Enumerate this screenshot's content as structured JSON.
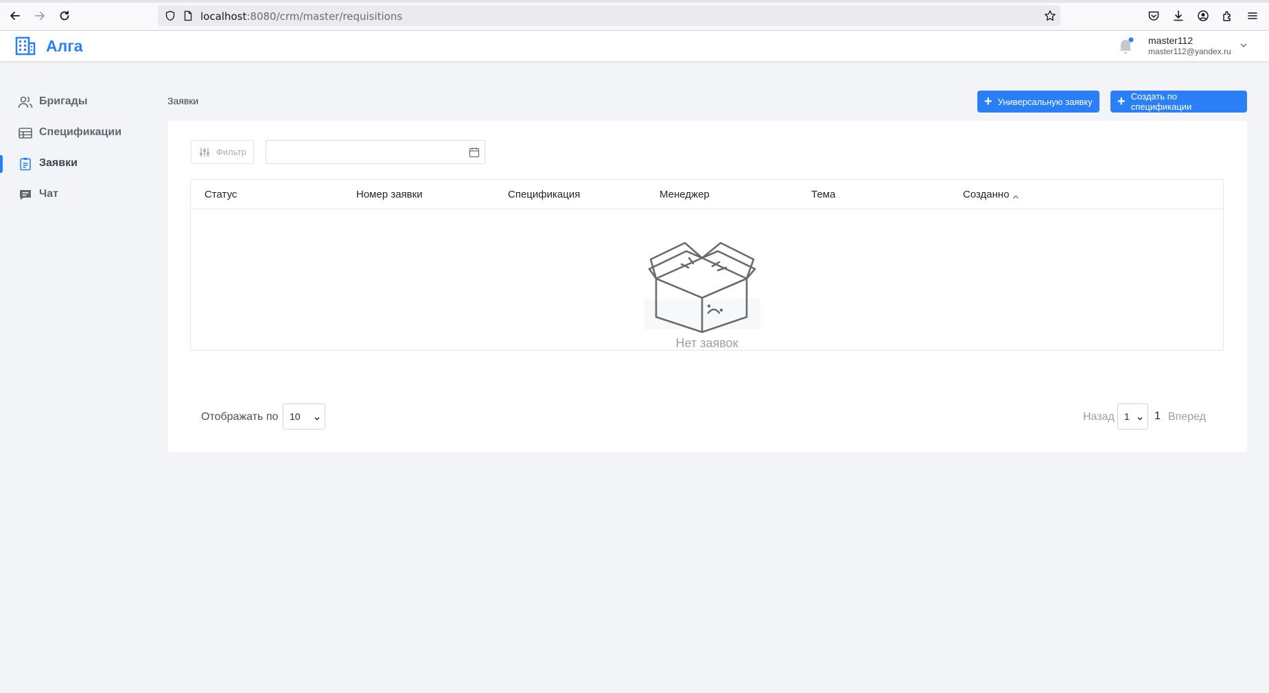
{
  "browser": {
    "url_host": "localhost",
    "url_path": ":8080/crm/master/requisitions"
  },
  "app": {
    "name": "Алга",
    "accent_color": "#2a7ff6"
  },
  "user": {
    "name": "master112",
    "email": "master112@yandex.ru"
  },
  "sidebar": {
    "items": [
      {
        "label": "Бригады",
        "icon": "users-icon",
        "active": false
      },
      {
        "label": "Спецификации",
        "icon": "table-icon",
        "active": false
      },
      {
        "label": "Заявки",
        "icon": "clipboard-icon",
        "active": true
      },
      {
        "label": "Чат",
        "icon": "chat-icon",
        "active": false
      }
    ]
  },
  "page": {
    "breadcrumb": "Заявки",
    "actions": {
      "universal": "Универсальную заявку",
      "by_spec": "Создать по спецификации"
    }
  },
  "filter": {
    "label": "Фильтр",
    "date_value": ""
  },
  "table": {
    "columns": [
      "Статус",
      "Номер заявки",
      "Спецификация",
      "Менеджер",
      "Тема",
      "Созданно"
    ],
    "sorted_column": "Созданно",
    "sort_direction": "asc",
    "rows": [],
    "empty_text": "Нет заявок"
  },
  "pagination": {
    "page_size_label": "Отображать по",
    "page_size": "10",
    "prev_label": "Назад",
    "page_select": "1",
    "current_page": "1",
    "next_label": "Вперед"
  }
}
